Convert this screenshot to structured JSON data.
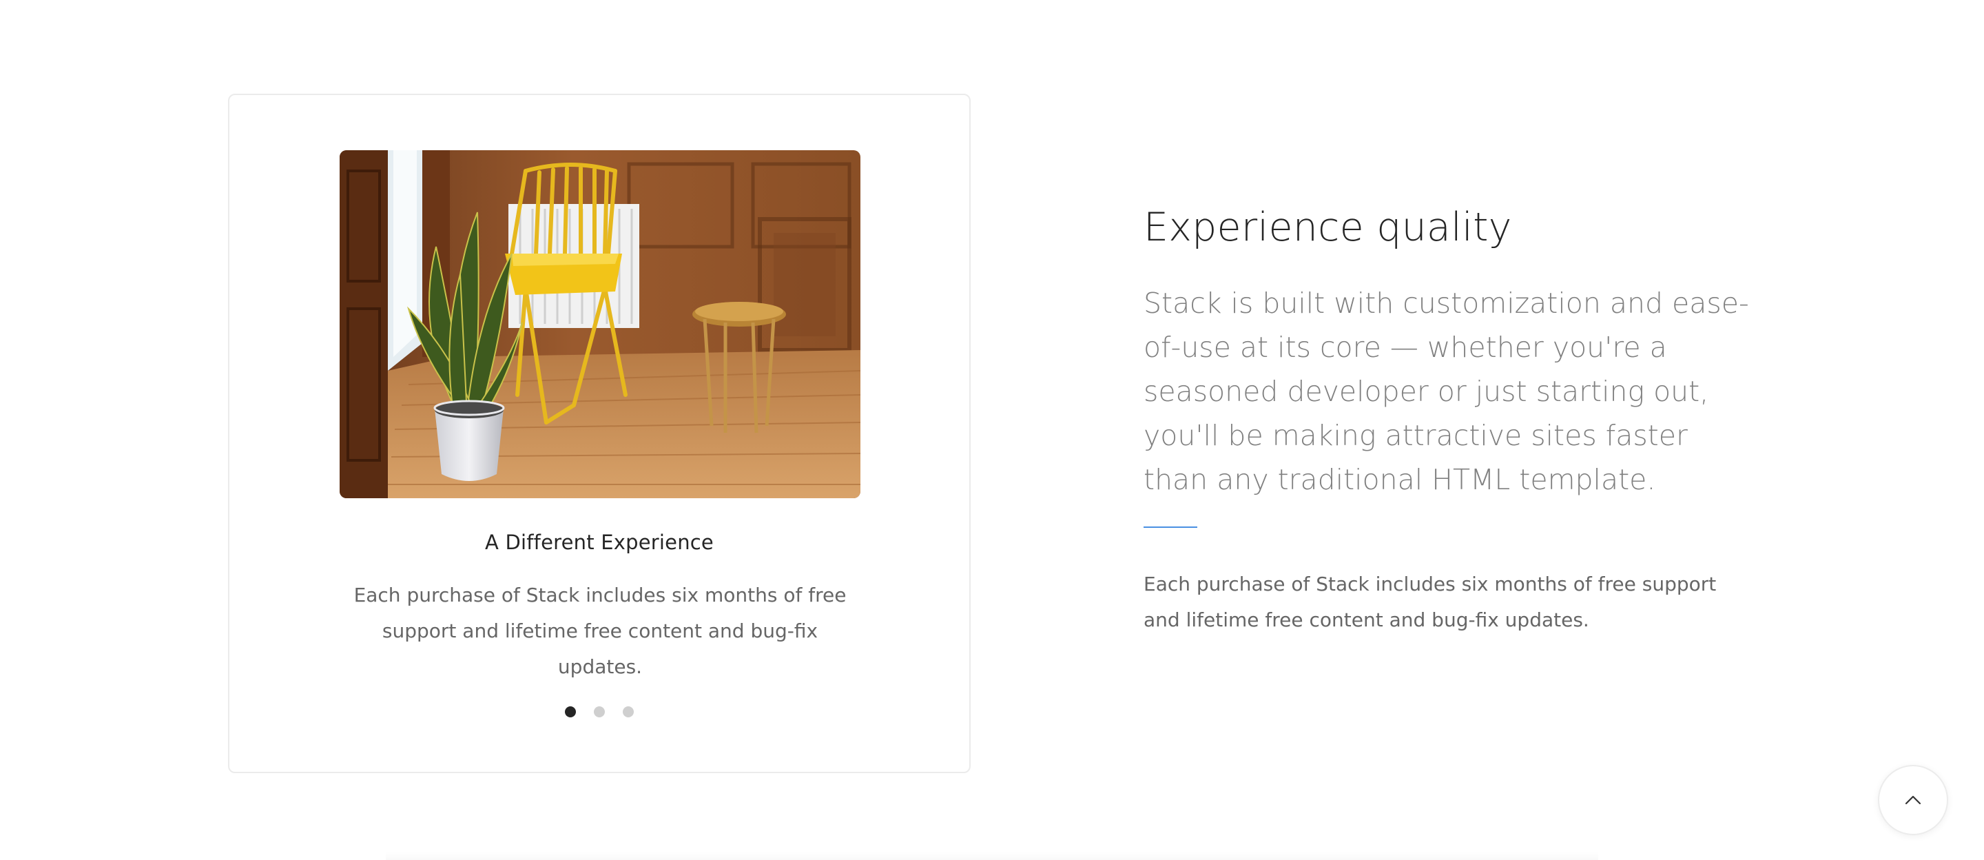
{
  "feature_card": {
    "image": "room-with-yellow-chair-plant-and-side-table",
    "title": "A Different Experience",
    "text": "Each purchase of Stack includes six months of free support and lifetime free content and bug-fix updates.",
    "slides": {
      "count": 3,
      "active": 1
    }
  },
  "content": {
    "heading": "Experience quality",
    "lead": "Stack is built with customization and ease-of-use at its core — whether you're a seasoned developer or just starting out, you'll be making attractive sites faster than any traditional HTML template.",
    "accent_color": "#4a90e2",
    "body": "Each purchase of Stack includes six months of free support and lifetime free content and bug-fix updates."
  },
  "back_to_top": {
    "icon": "chevron-up-icon"
  }
}
